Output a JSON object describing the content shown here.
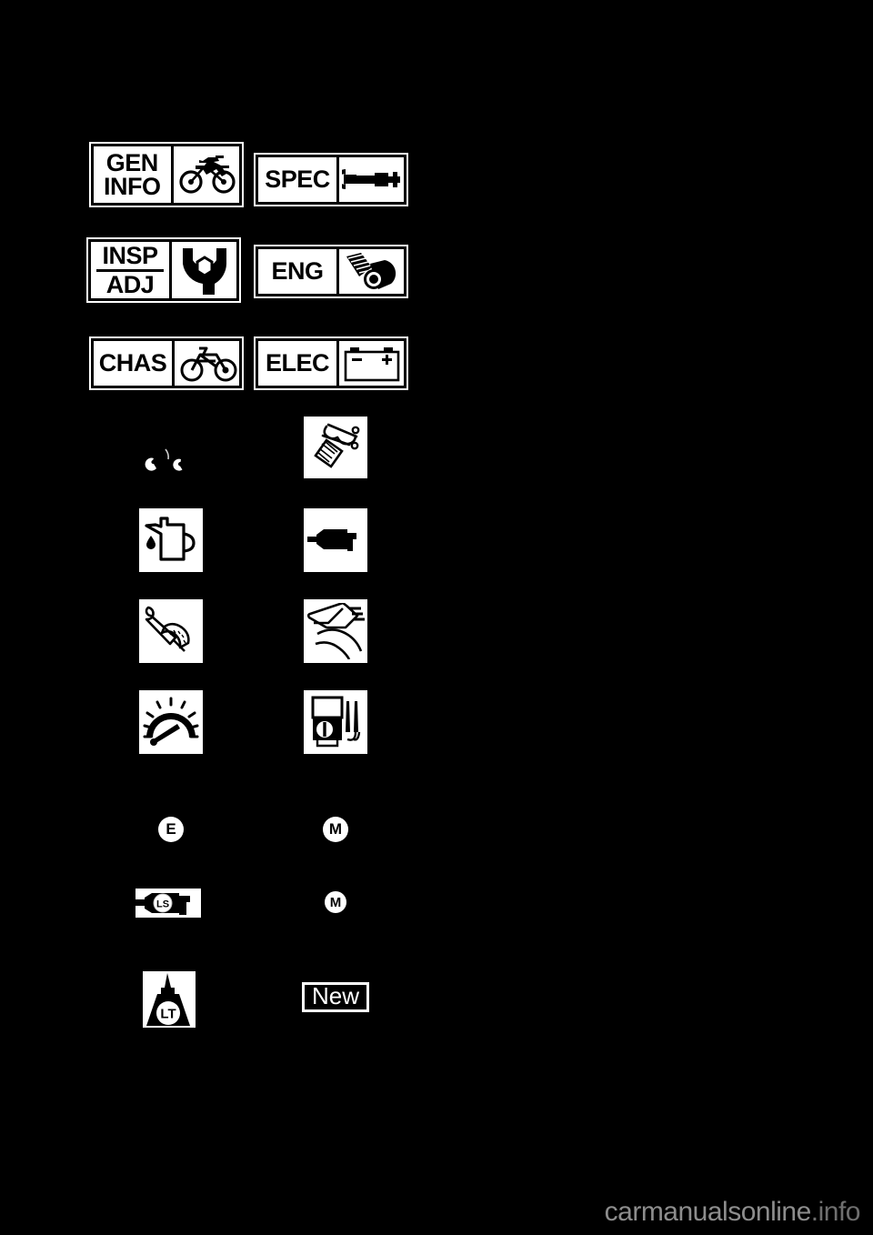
{
  "page": {
    "background_color": "#000000",
    "foreground_color": "#ffffff",
    "title": "Symbol legend page"
  },
  "section_tabs": [
    {
      "id": "geninfo",
      "label_line1": "GEN",
      "label_line2": "INFO",
      "icon": "dirt-motorcycle-icon",
      "divider": true
    },
    {
      "id": "spec",
      "label_line1": "SPEC",
      "label_line2": "",
      "icon": "micrometer-icon",
      "divider": true
    },
    {
      "id": "inspadj",
      "label_line1": "INSP",
      "label_line2": "ADJ",
      "icon": "wrench-nut-icon",
      "divider": true
    },
    {
      "id": "eng",
      "label_line1": "ENG",
      "label_line2": "",
      "icon": "piston-conrod-icon",
      "divider": true
    },
    {
      "id": "chas",
      "label_line1": "CHAS",
      "label_line2": "",
      "icon": "motorcycle-frame-icon",
      "divider": true
    },
    {
      "id": "elec",
      "label_line1": "ELEC",
      "label_line2": "",
      "icon": "battery-icon",
      "divider": true
    }
  ],
  "pictograms": [
    {
      "id": "tightening-torque",
      "icon": "tightening-torque-icon",
      "column": "left",
      "row": 1
    },
    {
      "id": "special-tool",
      "icon": "special-tool-icon",
      "column": "right",
      "row": 1
    },
    {
      "id": "engine-oil",
      "icon": "oil-can-icon",
      "column": "left",
      "row": 2
    },
    {
      "id": "grease-tube",
      "icon": "grease-tube-icon",
      "column": "right",
      "row": 2
    },
    {
      "id": "torque-wrench",
      "icon": "torque-wrench-icon",
      "column": "left",
      "row": 3
    },
    {
      "id": "vernier-caliper",
      "icon": "vernier-caliper-icon",
      "column": "right",
      "row": 3
    },
    {
      "id": "gauge",
      "icon": "dial-gauge-icon",
      "column": "left",
      "row": 4
    },
    {
      "id": "multimeter",
      "icon": "multimeter-icon",
      "column": "right",
      "row": 4
    }
  ],
  "lubricant_symbols": [
    {
      "id": "engine-oil-badge",
      "letter": "E",
      "shape": "circle",
      "column": "left",
      "row": 1
    },
    {
      "id": "molybdenum-badge",
      "letter": "M",
      "shape": "circle",
      "column": "right",
      "row": 1
    },
    {
      "id": "lithium-sealant",
      "letter": "LS",
      "shape": "tube-badge",
      "column": "left",
      "row": 2
    },
    {
      "id": "moly-grease-badge",
      "letter": "M",
      "shape": "circle",
      "column": "right",
      "row": 2
    },
    {
      "id": "locking-agent",
      "letter": "LT",
      "shape": "bottle-badge",
      "column": "left",
      "row": 3
    }
  ],
  "new_part": {
    "label": "New"
  },
  "watermark": {
    "text": "carmanualsonline",
    "suffix": ".info",
    "color": "#8d8d8d"
  }
}
